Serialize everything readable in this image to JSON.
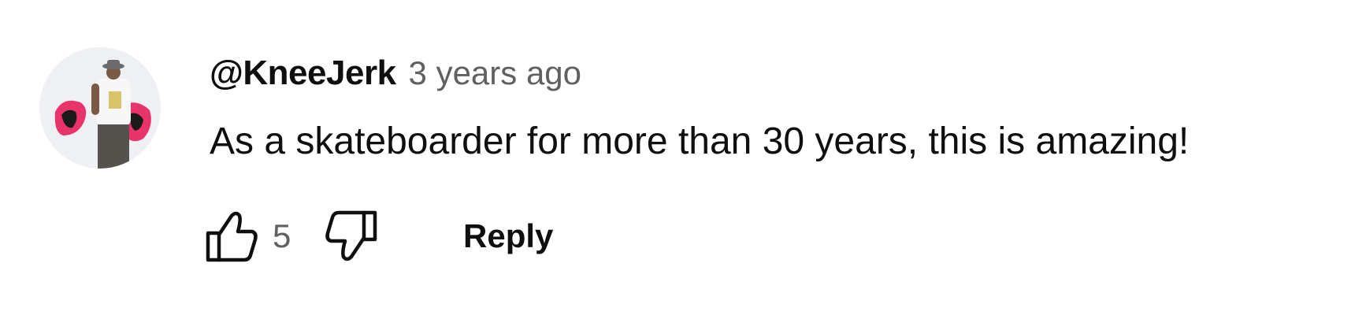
{
  "comment": {
    "author": "@KneeJerk",
    "timestamp": "3 years ago",
    "text": "As a skateboarder for more than 30 years, this is amazing!",
    "avatar": {
      "icon": "user-avatar-photo"
    },
    "actions": {
      "like_icon": "thumbs-up-icon",
      "like_count": "5",
      "dislike_icon": "thumbs-down-icon",
      "reply_label": "Reply"
    }
  },
  "colors": {
    "primary_text": "#0f0f0f",
    "secondary_text": "#606060",
    "background": "#ffffff",
    "avatar_accent": "#e8336b"
  }
}
